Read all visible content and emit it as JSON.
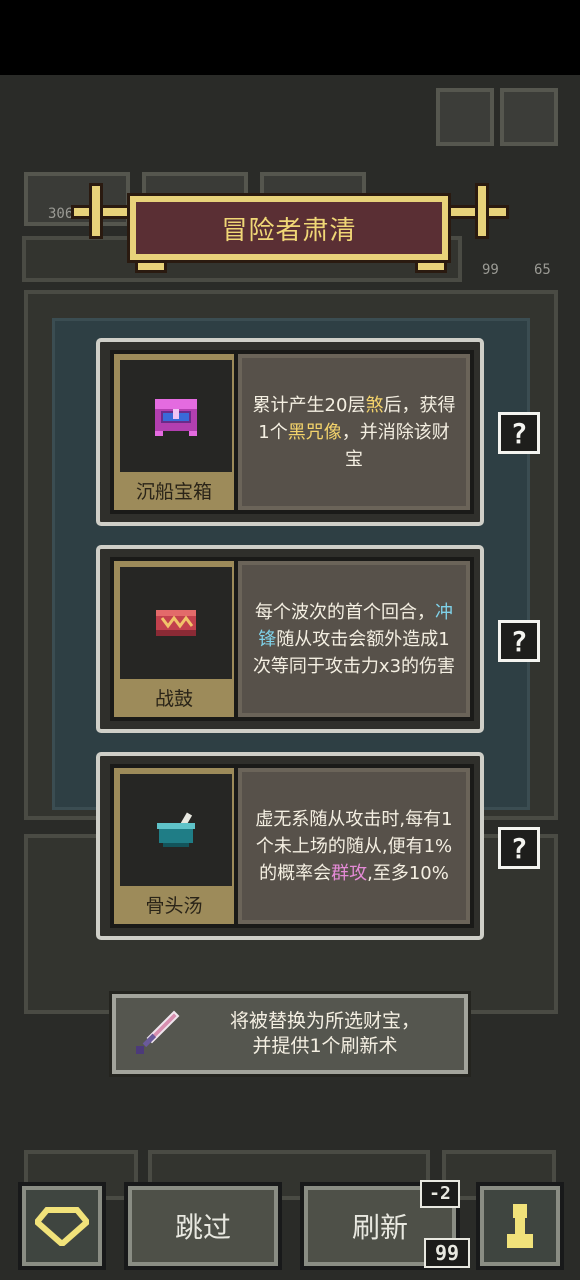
{
  "title": "冒险者肃清",
  "treasures": [
    {
      "name": "沉船宝箱",
      "icon": "sunken-chest-icon",
      "desc": [
        {
          "t": "累计产生20层"
        },
        {
          "t": "煞",
          "c": "y"
        },
        {
          "t": "后，获得1个"
        },
        {
          "t": "黑咒像",
          "c": "y"
        },
        {
          "t": "，并消除该财宝"
        }
      ]
    },
    {
      "name": "战鼓",
      "icon": "war-drum-icon",
      "desc": [
        {
          "t": "每个波次的首个回合，"
        },
        {
          "t": "冲锋",
          "c": "b"
        },
        {
          "t": "随从攻击会额外造成1次等同于攻击力x3的伤害"
        }
      ]
    },
    {
      "name": "骨头汤",
      "icon": "bone-soup-icon",
      "desc": [
        {
          "t": "虚无系随从攻击时,每有1个未上场的随从,便有1%的概率会"
        },
        {
          "t": "群攻",
          "c": "p"
        },
        {
          "t": ",至多10%"
        }
      ]
    }
  ],
  "tooltip": {
    "line1": "将被替换为所选财宝，",
    "line2": "并提供1个刷新术",
    "icon": "dagger-icon"
  },
  "buttons": {
    "skip": "跳过",
    "refresh": "刷新",
    "refresh_cost": "-2",
    "refresh_count": "99",
    "left_icon": "gem-icon",
    "right_icon": "pawn-icon"
  },
  "background": {
    "stat_a": "99",
    "stat_b": "65",
    "tab_counter": "306"
  },
  "colors": {
    "gold": "#e8d27a",
    "banner_bg": "#5a2f34",
    "highlight_yellow": "#f3d36b",
    "highlight_blue": "#7fd1e8",
    "highlight_purple": "#e48ad6"
  }
}
